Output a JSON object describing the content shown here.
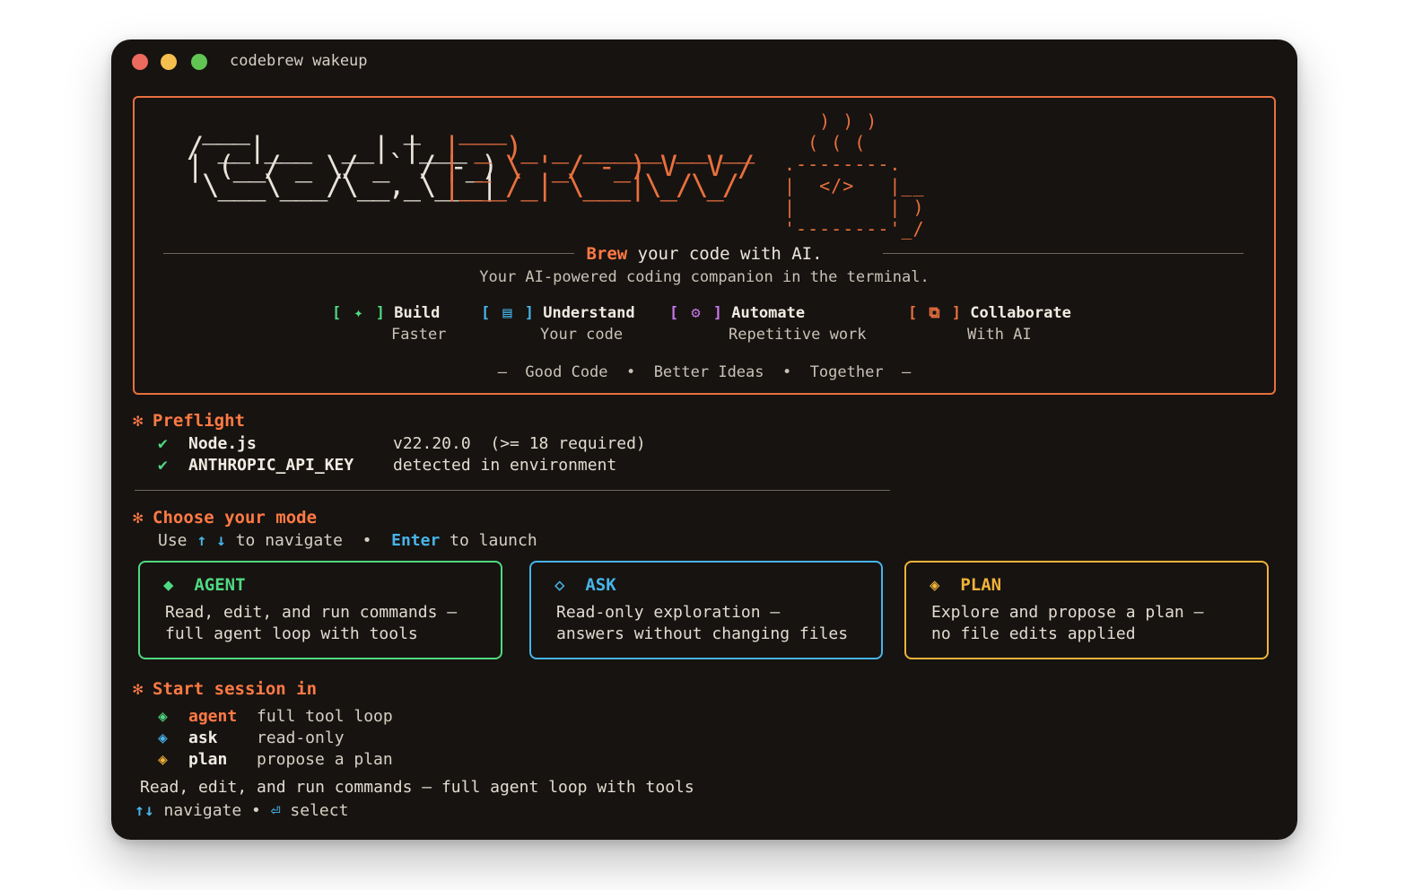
{
  "window": {
    "title": "codebrew wakeup"
  },
  "banner": {
    "tagline_accent": "Brew",
    "tagline_rest": " your code with AI.",
    "subtitle": "Your AI-powered coding companion in the terminal.",
    "features": [
      {
        "icon": "sparkle-icon",
        "glyph": "✦",
        "title": "Build",
        "subtitle": "Faster"
      },
      {
        "icon": "list-icon",
        "glyph": "▤",
        "title": "Understand",
        "subtitle": "Your code"
      },
      {
        "icon": "gear-icon",
        "glyph": "⚙",
        "title": "Automate",
        "subtitle": "Repetitive work"
      },
      {
        "icon": "copy-icon",
        "glyph": "⧉",
        "title": "Collaborate",
        "subtitle": "With AI"
      }
    ],
    "motto": "—  Good Code  •  Better Ideas  •  Together  —",
    "cup_code": "</>"
  },
  "preflight": {
    "heading": "Preflight",
    "checks": [
      {
        "name": "Node.js",
        "value": "v22.20.0  (>= 18 required)"
      },
      {
        "name": "ANTHROPIC_API_KEY",
        "value": "detected in environment"
      }
    ]
  },
  "mode_select": {
    "heading": "Choose your mode",
    "hint_use": "Use ",
    "hint_arrows": "↑ ↓",
    "hint_navigate": " to navigate  •  ",
    "hint_enter": "Enter",
    "hint_launch": " to launch",
    "cards": [
      {
        "glyph": "◆",
        "title": "AGENT",
        "desc": "Read, edit, and run commands —\nfull agent loop with tools"
      },
      {
        "glyph": "◇",
        "title": "ASK",
        "desc": "Read-only exploration —\nanswers without changing files"
      },
      {
        "glyph": "◈",
        "title": "PLAN",
        "desc": "Explore and propose a plan —\nno file edits applied"
      }
    ]
  },
  "session": {
    "heading": "Start session in",
    "modes": [
      {
        "glyph": "◈",
        "name": "agent",
        "desc": "full tool loop"
      },
      {
        "glyph": "◈",
        "name": "ask",
        "desc": "read-only"
      },
      {
        "glyph": "◈",
        "name": "plan",
        "desc": "propose a plan"
      }
    ],
    "selected_desc": "Read, edit, and run commands — full agent loop with tools",
    "key_nav": "↑↓",
    "nav_label": " navigate • ",
    "key_select": "⏎",
    "select_label": " select"
  },
  "colors": {
    "accent_orange": "#e8703f",
    "green": "#4fd982",
    "blue": "#47b4ea",
    "yellow": "#f0b23a",
    "purple": "#c777e8",
    "background": "#171310"
  }
}
